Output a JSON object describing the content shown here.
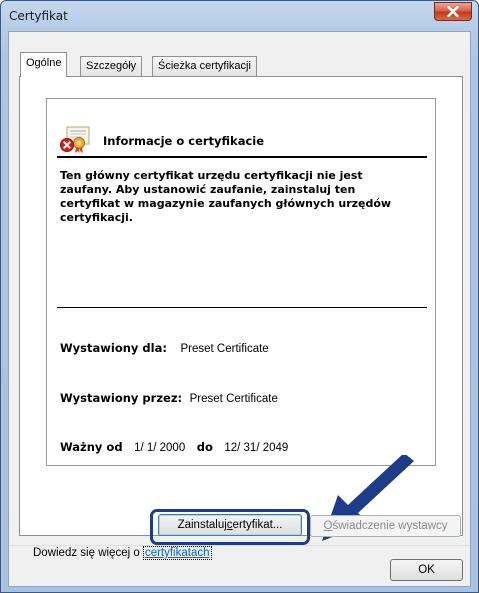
{
  "window": {
    "title": "Certyfikat",
    "close_icon": "close-icon"
  },
  "tabs": [
    {
      "label": "Ogólne",
      "active": true
    },
    {
      "label": "Szczegóły",
      "active": false
    },
    {
      "label": "Ścieżka certyfikacji",
      "active": false
    }
  ],
  "info": {
    "icon": "certificate-error-icon",
    "title": "Informacje o certyfikacie",
    "warning_lines": [
      "Ten główny certyfikat urzędu certyfikacji nie jest",
      "zaufany. Aby ustanowić zaufanie, zainstaluj ten",
      "certyfikat w magazynie zaufanych głównych urzędów",
      "certyfikacji."
    ],
    "issued_to_label": "Wystawiony dla:",
    "issued_to_value": "Preset Certificate",
    "issued_by_label": "Wystawiony przez:",
    "issued_by_value": "Preset Certificate",
    "valid_from_label": "Ważny od",
    "valid_from_value": "1/ 1/ 2000",
    "valid_to_label": "do",
    "valid_to_value": "12/ 31/ 2049"
  },
  "buttons": {
    "install_prefix": "Zainstaluj ",
    "install_underlined": "c",
    "install_suffix": "ertyfikat...",
    "statement_underlined": "O",
    "statement_suffix": "świadczenie wystawcy",
    "ok": "OK"
  },
  "learn_more": {
    "prefix": "Dowiedz się więcej o ",
    "link": "certyfikatach"
  },
  "colors": {
    "accent": "#1f3c88",
    "link": "#0066cc",
    "close_button": "#c23a1f"
  }
}
